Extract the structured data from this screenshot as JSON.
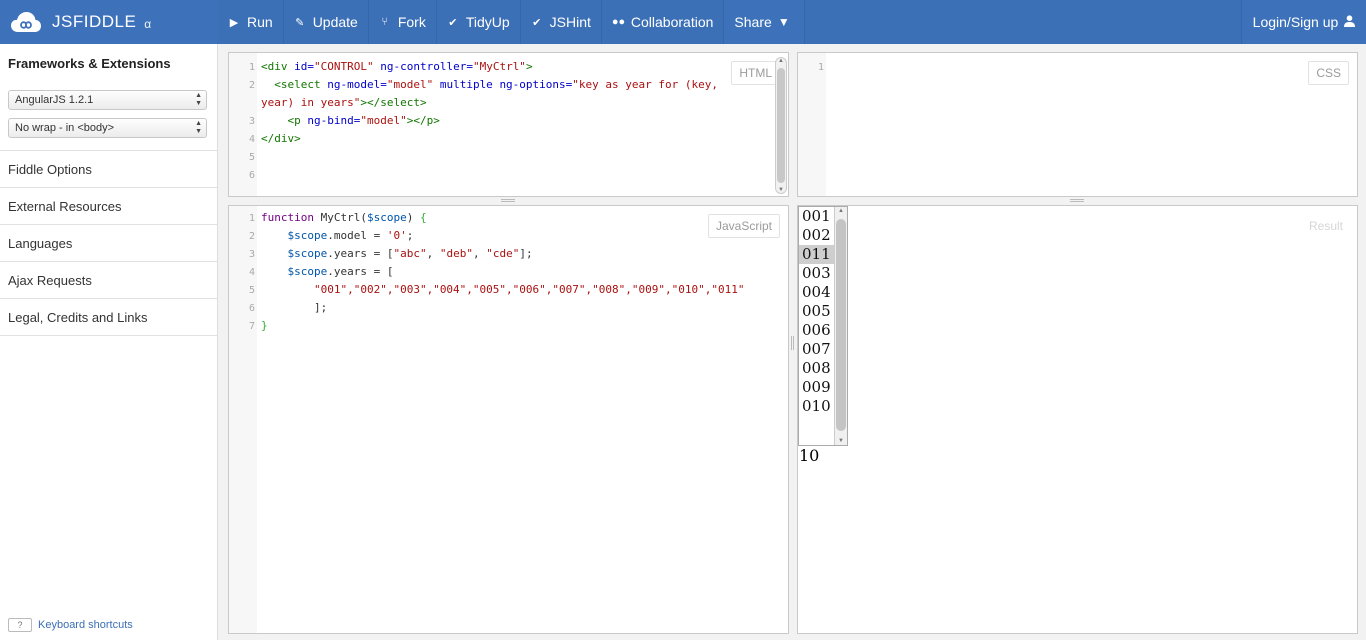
{
  "app": {
    "name": "JSFIDDLE",
    "stage": "α"
  },
  "toolbar": {
    "run": "Run",
    "update": "Update",
    "fork": "Fork",
    "tidyup": "TidyUp",
    "jshint": "JSHint",
    "collaboration": "Collaboration",
    "share": "Share",
    "login": "Login/Sign up"
  },
  "sidebar": {
    "frameworks_title": "Frameworks & Extensions",
    "framework_select": "AngularJS 1.2.1",
    "wrap_select": "No wrap - in <body>",
    "items": [
      "Fiddle Options",
      "External Resources",
      "Languages",
      "Ajax Requests",
      "Legal, Credits and Links"
    ],
    "shortcut_key": "?",
    "shortcuts_label": "Keyboard shortcuts"
  },
  "panels": {
    "html_label": "HTML",
    "css_label": "CSS",
    "js_label": "JavaScript",
    "result_label": "Result",
    "html_lines": [
      "1",
      "2",
      "3",
      "4",
      "5",
      "6"
    ],
    "css_lines": [
      "1"
    ],
    "js_lines": [
      "1",
      "2",
      "3",
      "4",
      "5",
      "6",
      "7"
    ],
    "html": {
      "l1": {
        "tag_open": "<div",
        "attr1": "id=",
        "val1": "\"CONTROL\"",
        "attr2": "ng-controller=",
        "val2": "\"MyCtrl\"",
        "close": ">"
      },
      "l2": {
        "tag_open": "<select",
        "attr1": "ng-model=",
        "val1": "\"model\"",
        "attr2": "multiple",
        "attr3": "ng-options=",
        "val3a": "\"key as year for (key,",
        "val3b": "year) in years\"",
        "close": "></select>"
      },
      "l3": {
        "tag_open": "<p",
        "attr1": "ng-bind=",
        "val1": "\"model\"",
        "close": "></p>"
      },
      "l4": {
        "tag": "</div>"
      }
    },
    "js": {
      "l1": {
        "kw": "function",
        "name": " MyCtrl(",
        "param": "$scope",
        "close": ") ",
        "brace": "{"
      },
      "l2": {
        "var": "$scope",
        "rest": ".model = ",
        "str": "'0'",
        "end": ";"
      },
      "l3": {
        "var": "$scope",
        "rest": ".years = [",
        "s1": "\"abc\"",
        "s2": "\"deb\"",
        "s3": "\"cde\"",
        "end": "];"
      },
      "l4": {
        "var": "$scope",
        "rest": ".years = ["
      },
      "l5": {
        "items": "\"001\",\"002\",\"003\",\"004\",\"005\",\"006\",\"007\",\"008\",\"009\",\"010\",\"011\""
      },
      "l6": {
        "text": "];"
      },
      "l7": {
        "brace": "}"
      }
    }
  },
  "result": {
    "options": [
      "001",
      "002",
      "011",
      "003",
      "004",
      "005",
      "006",
      "007",
      "008",
      "009",
      "010"
    ],
    "selected_index": 2,
    "output": "10"
  },
  "colors": {
    "topbar": "#3b6fb6",
    "link": "#3b6fb6"
  }
}
